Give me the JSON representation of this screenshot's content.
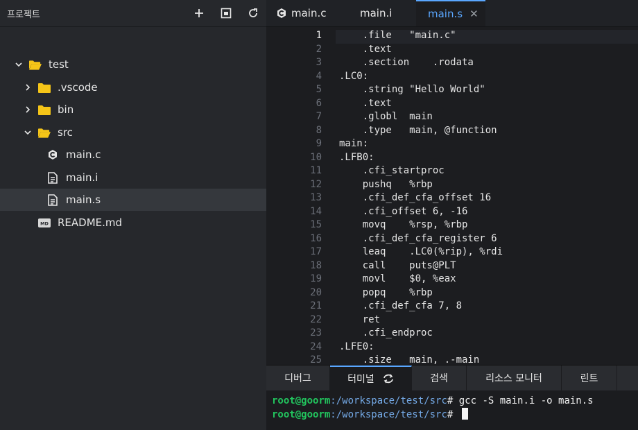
{
  "sidebar": {
    "title": "프로젝트",
    "actions": [
      {
        "name": "add-icon"
      },
      {
        "name": "collapse-icon"
      },
      {
        "name": "refresh-icon"
      }
    ],
    "tree": [
      {
        "label": "test",
        "icon": "folder-open-icon",
        "expanded": true,
        "depth": 0
      },
      {
        "label": ".vscode",
        "icon": "folder-icon",
        "expanded": false,
        "depth": 1
      },
      {
        "label": "bin",
        "icon": "folder-icon",
        "expanded": false,
        "depth": 1
      },
      {
        "label": "src",
        "icon": "folder-open-icon",
        "expanded": true,
        "depth": 1
      },
      {
        "label": "main.c",
        "icon": "c-file-icon",
        "depth": 2
      },
      {
        "label": "main.i",
        "icon": "file-icon",
        "depth": 2
      },
      {
        "label": "main.s",
        "icon": "file-icon",
        "depth": 2,
        "selected": true
      },
      {
        "label": "README.md",
        "icon": "markdown-icon",
        "depth": 1
      }
    ]
  },
  "editor": {
    "tabs": [
      {
        "label": "main.c",
        "icon": "c-file-icon"
      },
      {
        "label": "main.i"
      },
      {
        "label": "main.s",
        "active": true,
        "close": "✕"
      }
    ],
    "current_line": 1,
    "lines": [
      "    .file   \"main.c\"",
      "    .text",
      "    .section    .rodata",
      ".LC0:",
      "    .string \"Hello World\"",
      "    .text",
      "    .globl  main",
      "    .type   main, @function",
      "main:",
      ".LFB0:",
      "    .cfi_startproc",
      "    pushq   %rbp",
      "    .cfi_def_cfa_offset 16",
      "    .cfi_offset 6, -16",
      "    movq    %rsp, %rbp",
      "    .cfi_def_cfa_register 6",
      "    leaq    .LC0(%rip), %rdi",
      "    call    puts@PLT",
      "    movl    $0, %eax",
      "    popq    %rbp",
      "    .cfi_def_cfa 7, 8",
      "    ret",
      "    .cfi_endproc",
      ".LFE0:",
      "    .size   main, .-main"
    ]
  },
  "panel": {
    "tabs": [
      {
        "label": "디버그"
      },
      {
        "label": "터미널",
        "active": true,
        "icon": "sync-icon"
      },
      {
        "label": "검색"
      },
      {
        "label": "리소스 모니터"
      },
      {
        "label": "린트"
      }
    ],
    "terminal": [
      {
        "user": "root@goorm",
        "path": ":/workspace/test/src",
        "cmd": "# gcc -S main.i -o main.s"
      },
      {
        "user": "root@goorm",
        "path": ":/workspace/test/src",
        "cmd": "# "
      }
    ]
  },
  "colors": {
    "accent": "#5aa7ff",
    "folder": "#f5c518",
    "prompt_user": "#22c55e",
    "prompt_path": "#74a9e6"
  }
}
